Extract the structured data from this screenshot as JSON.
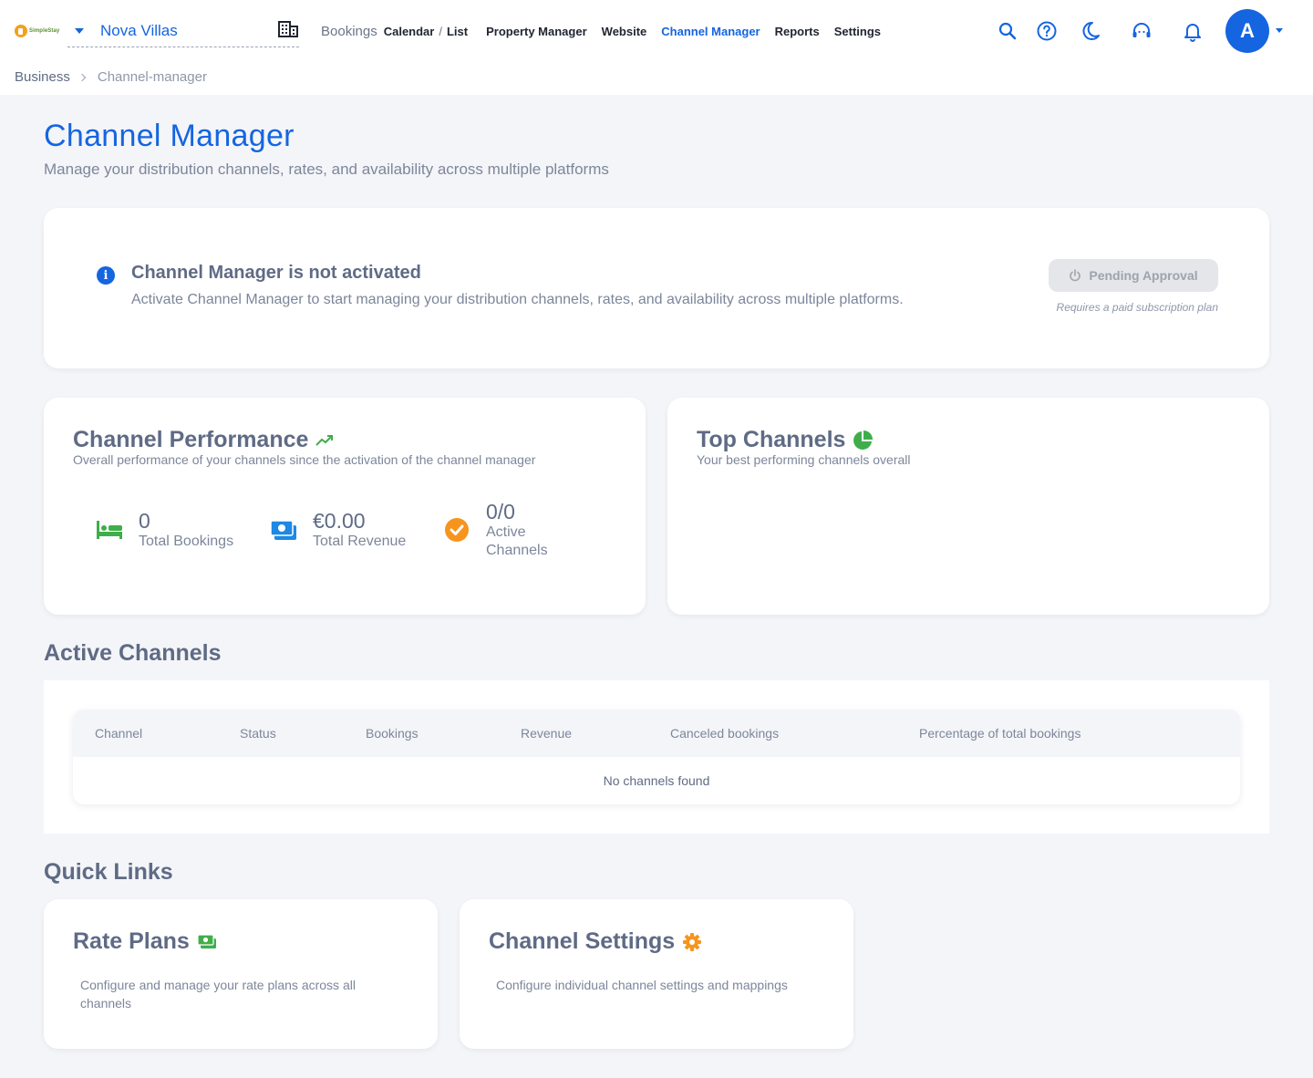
{
  "brand": {
    "logo_text": "SimpleStay"
  },
  "property": {
    "name": "Nova Villas"
  },
  "nav": {
    "bookings": "Bookings",
    "calendar": "Calendar",
    "separator": "/",
    "list": "List",
    "property_manager": "Property Manager",
    "website": "Website",
    "channel_manager": "Channel Manager",
    "reports": "Reports",
    "settings": "Settings"
  },
  "header_icons": [
    "search-icon",
    "help-icon",
    "dark-mode-icon",
    "support-icon",
    "notifications-icon"
  ],
  "user": {
    "initial": "A"
  },
  "breadcrumb": {
    "parent": "Business",
    "current": "Channel-manager"
  },
  "page": {
    "title": "Channel Manager",
    "subtitle": "Manage your distribution channels, rates, and availability across multiple platforms"
  },
  "activation": {
    "title": "Channel Manager is not activated",
    "description": "Activate Channel Manager to start managing your distribution channels, rates, and availability across multiple platforms.",
    "button_label": "Pending Approval",
    "note": "Requires a paid subscription plan"
  },
  "performance": {
    "title": "Channel Performance",
    "subtitle": "Overall performance of your channels since the activation of the channel manager",
    "stats": [
      {
        "value": "0",
        "label": "Total Bookings",
        "icon": "bed-icon"
      },
      {
        "value": "€0.00",
        "label": "Total Revenue",
        "icon": "money-icon"
      },
      {
        "value": "0/0",
        "label": "Active Channels",
        "icon": "check-circle-icon"
      }
    ]
  },
  "top_channels": {
    "title": "Top Channels",
    "subtitle": "Your best performing channels overall"
  },
  "active_channels": {
    "title": "Active Channels",
    "columns": [
      "Channel",
      "Status",
      "Bookings",
      "Revenue",
      "Canceled bookings",
      "Percentage of total bookings"
    ],
    "empty_text": "No channels found"
  },
  "quick_links": {
    "title": "Quick Links",
    "items": [
      {
        "title": "Rate Plans",
        "description": "Configure and manage your rate plans across all channels",
        "icon": "money-icon"
      },
      {
        "title": "Channel Settings",
        "description": "Configure individual channel settings and mappings",
        "icon": "gear-icon"
      }
    ]
  },
  "colors": {
    "accent": "#1565e0",
    "success": "#3fae4a",
    "warning": "#f7941d",
    "text": "#5f6b85"
  }
}
